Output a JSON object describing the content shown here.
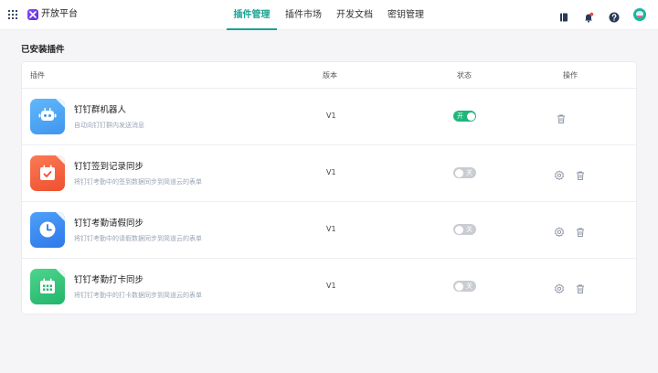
{
  "header": {
    "app_title": "开放平台",
    "tabs": [
      {
        "label": "插件管理",
        "active": true
      },
      {
        "label": "插件市场",
        "active": false
      },
      {
        "label": "开发文档",
        "active": false
      },
      {
        "label": "密钥管理",
        "active": false
      }
    ],
    "icons": [
      "grid-menu-icon",
      "app-logo-icon",
      "book-icon",
      "bell-icon",
      "help-icon",
      "user-avatar"
    ],
    "notification_dot": true
  },
  "section_title": "已安装插件",
  "table": {
    "columns": {
      "plugin": "插件",
      "version": "版本",
      "status": "状态",
      "action": "操作"
    },
    "rows": [
      {
        "name": "钉钉群机器人",
        "desc": "自动向钉钉群内发送消息",
        "version": "V1",
        "status_label": "开",
        "enabled": true,
        "icon": "robot-icon",
        "color": "#4aa8f5",
        "has_settings": false
      },
      {
        "name": "钉钉签到记录同步",
        "desc": "将钉钉考勤中的签到数据同步到简道云的表单",
        "version": "V1",
        "status_label": "关",
        "enabled": false,
        "icon": "calendar-check-icon",
        "color": "#f5663f",
        "has_settings": true
      },
      {
        "name": "钉钉考勤请假同步",
        "desc": "将钉钉考勤中的请假数据同步到简道云的表单",
        "version": "V1",
        "status_label": "关",
        "enabled": false,
        "icon": "clock-icon",
        "color": "#3d8cf0",
        "has_settings": true
      },
      {
        "name": "钉钉考勤打卡同步",
        "desc": "将钉钉考勤中的打卡数据同步到简道云的表单",
        "version": "V1",
        "status_label": "关",
        "enabled": false,
        "icon": "calendar-grid-icon",
        "color": "#2fc37a",
        "has_settings": true
      }
    ]
  },
  "colors": {
    "accent": "#1aa394",
    "switch_on": "#21b57a",
    "switch_off": "#c9ccd1"
  }
}
